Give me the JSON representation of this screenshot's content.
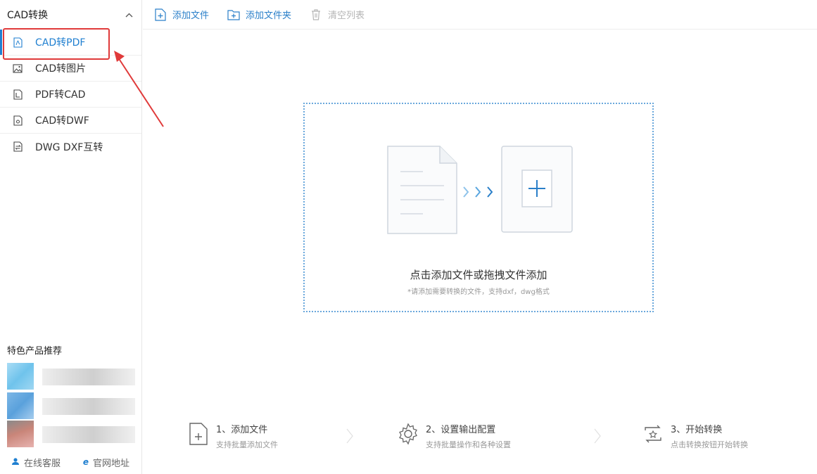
{
  "sidebar": {
    "header": "CAD转换",
    "items": [
      {
        "label": "CAD转PDF",
        "icon": "pdf-file-icon"
      },
      {
        "label": "CAD转图片",
        "icon": "image-icon"
      },
      {
        "label": "PDF转CAD",
        "icon": "cad-file-icon"
      },
      {
        "label": "CAD转DWF",
        "icon": "dwf-file-icon"
      },
      {
        "label": "DWG DXF互转",
        "icon": "swap-file-icon"
      }
    ],
    "featured_title": "特色产品推荐",
    "footer": {
      "online_service": "在线客服",
      "official_site": "官网地址"
    }
  },
  "toolbar": {
    "add_file": "添加文件",
    "add_folder": "添加文件夹",
    "clear_list": "清空列表"
  },
  "dropzone": {
    "title": "点击添加文件或拖拽文件添加",
    "hint": "*请添加需要转换的文件，支持dxf，dwg格式"
  },
  "steps": [
    {
      "title": "1、添加文件",
      "subtitle": "支持批量添加文件"
    },
    {
      "title": "2、设置输出配置",
      "subtitle": "支持批量操作和各种设置"
    },
    {
      "title": "3、开始转换",
      "subtitle": "点击转换按钮开始转换"
    }
  ],
  "colors": {
    "accent": "#1f7fd0",
    "annotation": "#e03a3a",
    "dropzone_border": "#6aa8dc"
  }
}
